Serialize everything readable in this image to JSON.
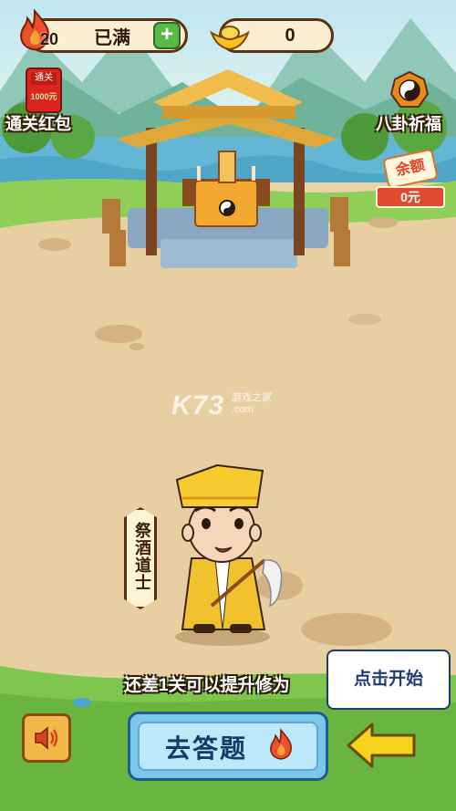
{
  "hud": {
    "energy_count": "20",
    "energy_status": "已满",
    "gold_count": "0"
  },
  "side": {
    "left_reward": {
      "tag": "通关",
      "amount": "1000元",
      "label": "通关红包"
    },
    "right_reward": {
      "label": "八卦祈福"
    },
    "balance": {
      "tag": "余额",
      "value": "0元"
    }
  },
  "character": {
    "name": "祭酒道士"
  },
  "watermark": {
    "logo": "K73",
    "sub_top": "游戏之家",
    "sub_bottom": ".com"
  },
  "hint": "还差1关可以提升修为",
  "start_bubble": "点击开始",
  "buttons": {
    "answer_label": "去答题"
  },
  "icons": {
    "energy": "flame-icon",
    "add": "plus-icon",
    "gold": "gold-ingot-icon",
    "bagua": "yin-yang-icon",
    "sound": "speaker-icon",
    "pointer": "left-arrow-icon"
  },
  "colors": {
    "pill_bg": "#fbeed3",
    "pill_border": "#5a2f12",
    "button_blue": "#7cc8ec",
    "arrow_yellow": "#f7d21c",
    "flame": "#e8512a"
  }
}
